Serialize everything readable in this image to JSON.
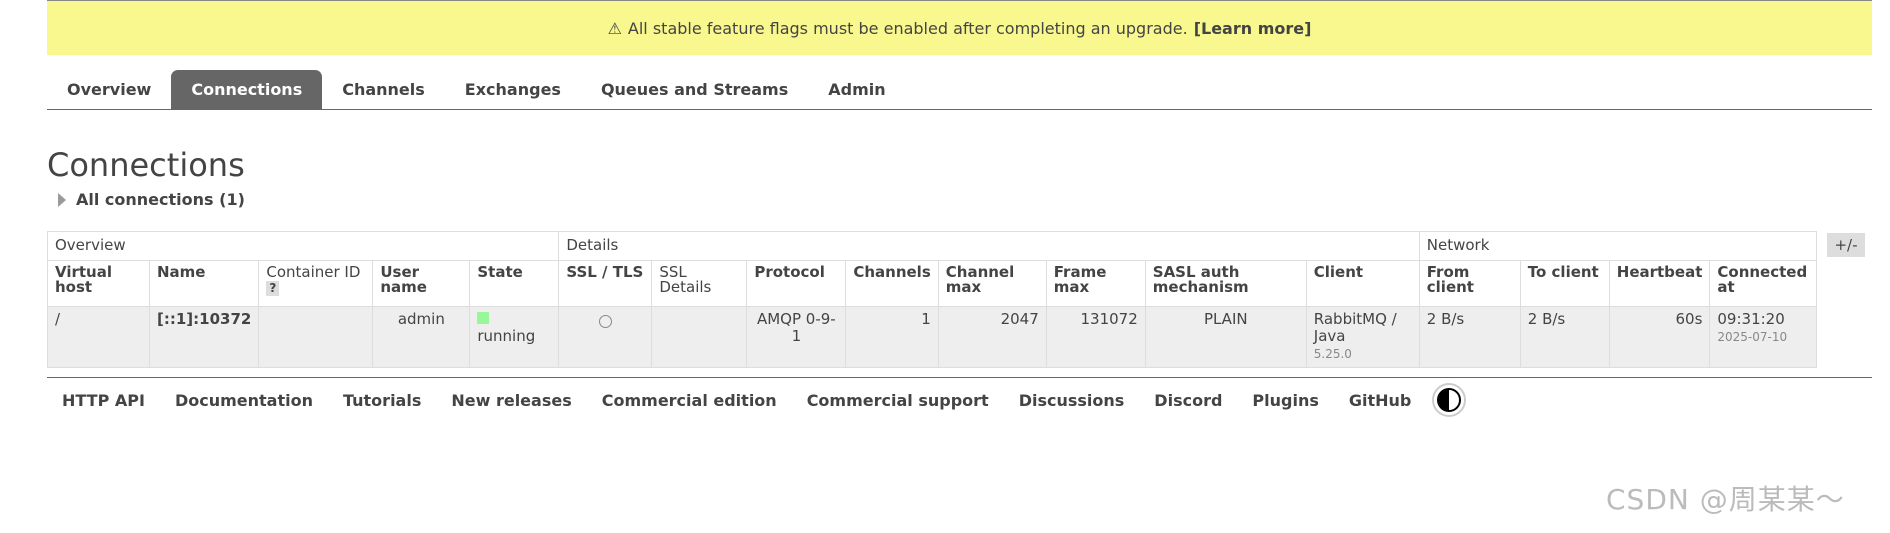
{
  "banner": {
    "text": "All stable feature flags must be enabled after completing an upgrade.",
    "link": "[Learn more]"
  },
  "tabs": [
    {
      "label": "Overview",
      "active": false
    },
    {
      "label": "Connections",
      "active": true
    },
    {
      "label": "Channels",
      "active": false
    },
    {
      "label": "Exchanges",
      "active": false
    },
    {
      "label": "Queues and Streams",
      "active": false
    },
    {
      "label": "Admin",
      "active": false
    }
  ],
  "page": {
    "title": "Connections",
    "section": "All connections (1)",
    "toggle": "+/-"
  },
  "table": {
    "groups": [
      "Overview",
      "Details",
      "Network"
    ],
    "columns": [
      "Virtual host",
      "Name",
      "Container ID",
      "User name",
      "State",
      "SSL / TLS",
      "SSL Details",
      "Protocol",
      "Channels",
      "Channel max",
      "Frame max",
      "SASL auth mechanism",
      "Client",
      "From client",
      "To client",
      "Heartbeat",
      "Connected at"
    ],
    "help": "?",
    "row": {
      "vhost": "/",
      "name": "[::1]:10372",
      "container_id": "",
      "user": "admin",
      "state": "running",
      "ssl_details": "",
      "protocol": "AMQP 0-9-1",
      "channels": "1",
      "channel_max": "2047",
      "frame_max": "131072",
      "sasl": "PLAIN",
      "client": "RabbitMQ / Java",
      "client_version": "5.25.0",
      "from_client": "2 B/s",
      "to_client": "2 B/s",
      "heartbeat": "60s",
      "connected_time": "09:31:20",
      "connected_date": "2025-07-10"
    }
  },
  "footer": [
    "HTTP API",
    "Documentation",
    "Tutorials",
    "New releases",
    "Commercial edition",
    "Commercial support",
    "Discussions",
    "Discord",
    "Plugins",
    "GitHub"
  ],
  "watermark": "CSDN @周某某～",
  "colors": {
    "banner": "#f8f88e",
    "active_tab": "#666666",
    "running": "#98f898"
  }
}
